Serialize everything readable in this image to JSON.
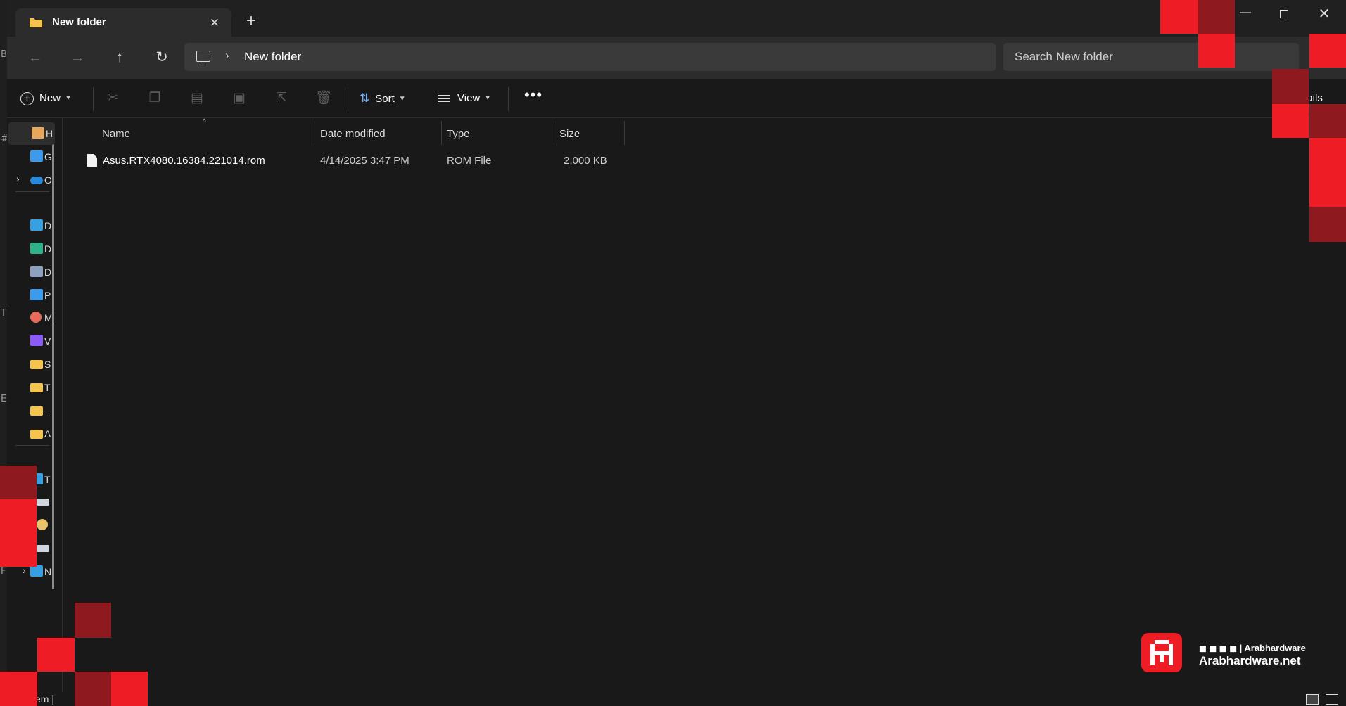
{
  "tab": {
    "title": "New folder",
    "close_glyph": "✕",
    "new_tab_glyph": "+"
  },
  "window_controls": {
    "minimize": "—",
    "close": "✕"
  },
  "navigation": {
    "back": "←",
    "forward": "→",
    "up": "↑",
    "refresh": "↻"
  },
  "address": {
    "separator": "›",
    "crumb": "New folder"
  },
  "search": {
    "placeholder": "Search New folder"
  },
  "command_bar": {
    "new_label": "New",
    "sort_label": "Sort",
    "view_label": "View",
    "more_glyph": "•••",
    "details_label": "Details",
    "icons": [
      "cut-icon",
      "copy-icon",
      "paste-icon",
      "rename-icon",
      "share-icon",
      "delete-icon"
    ]
  },
  "nav_pane": {
    "items": [
      {
        "name": "home",
        "label": "H",
        "icon": "home-icon",
        "color": "#e8a85b",
        "expandable": false,
        "selected": true
      },
      {
        "name": "gallery",
        "label": "G",
        "icon": "gallery-icon",
        "color": "#3d9be9",
        "expandable": false
      },
      {
        "name": "onedrive",
        "label": "O",
        "icon": "onedrive-icon",
        "color": "#2b88d8",
        "expandable": true
      },
      {
        "name": "desktop",
        "label": "D",
        "icon": "desktop-icon",
        "color": "#37a0e0",
        "expandable": false
      },
      {
        "name": "downloads",
        "label": "D",
        "icon": "downloads-icon",
        "color": "#2fb18a",
        "expandable": false
      },
      {
        "name": "documents",
        "label": "D",
        "icon": "documents-icon",
        "color": "#8ea2c0",
        "expandable": false
      },
      {
        "name": "pictures",
        "label": "P",
        "icon": "pictures-icon",
        "color": "#3d9be9",
        "expandable": false
      },
      {
        "name": "music",
        "label": "M",
        "icon": "music-icon",
        "color": "#e86b5a",
        "expandable": false
      },
      {
        "name": "videos",
        "label": "V",
        "icon": "videos-icon",
        "color": "#8a5cf5",
        "expandable": false
      },
      {
        "name": "folder-s",
        "label": "S",
        "icon": "folder-icon",
        "color": "#f3c44e",
        "expandable": false
      },
      {
        "name": "folder-t",
        "label": "T",
        "icon": "folder-icon",
        "color": "#f3c44e",
        "expandable": false
      },
      {
        "name": "folder-dash",
        "label": "_",
        "icon": "folder-icon",
        "color": "#f3c44e",
        "expandable": false
      },
      {
        "name": "folder-a",
        "label": "A",
        "icon": "folder-icon",
        "color": "#f3c44e",
        "expandable": false
      },
      {
        "name": "this-pc",
        "label": "T",
        "icon": "pc-icon",
        "color": "#37a0e0",
        "expandable": false
      },
      {
        "name": "drive-1",
        "label": "",
        "icon": "drive-icon",
        "color": "#cfd6df",
        "expandable": true
      },
      {
        "name": "drive-2",
        "label": "",
        "icon": "disc-icon",
        "color": "#e9c46a",
        "expandable": true
      },
      {
        "name": "drive-3",
        "label": "",
        "icon": "drive-icon",
        "color": "#cfd6df",
        "expandable": true
      },
      {
        "name": "network",
        "label": "N",
        "icon": "network-icon",
        "color": "#37a0e0",
        "expandable": true
      }
    ]
  },
  "file_list": {
    "columns": {
      "name": "Name",
      "date": "Date modified",
      "type": "Type",
      "size": "Size"
    },
    "sort_caret": "^",
    "rows": [
      {
        "name": "Asus.RTX4080.16384.221014.rom",
        "date": "4/14/2025 3:47 PM",
        "type": "ROM File",
        "size": "2,000 KB"
      }
    ]
  },
  "status_bar": {
    "text": "em |"
  },
  "desktop_chars": [
    "B",
    "T",
    "E",
    "F"
  ],
  "brand": {
    "social": "◼ ◼ ◼ ◼ | Arabhardware",
    "site": "Arabhardware.net",
    "color": "#ee1c25"
  }
}
